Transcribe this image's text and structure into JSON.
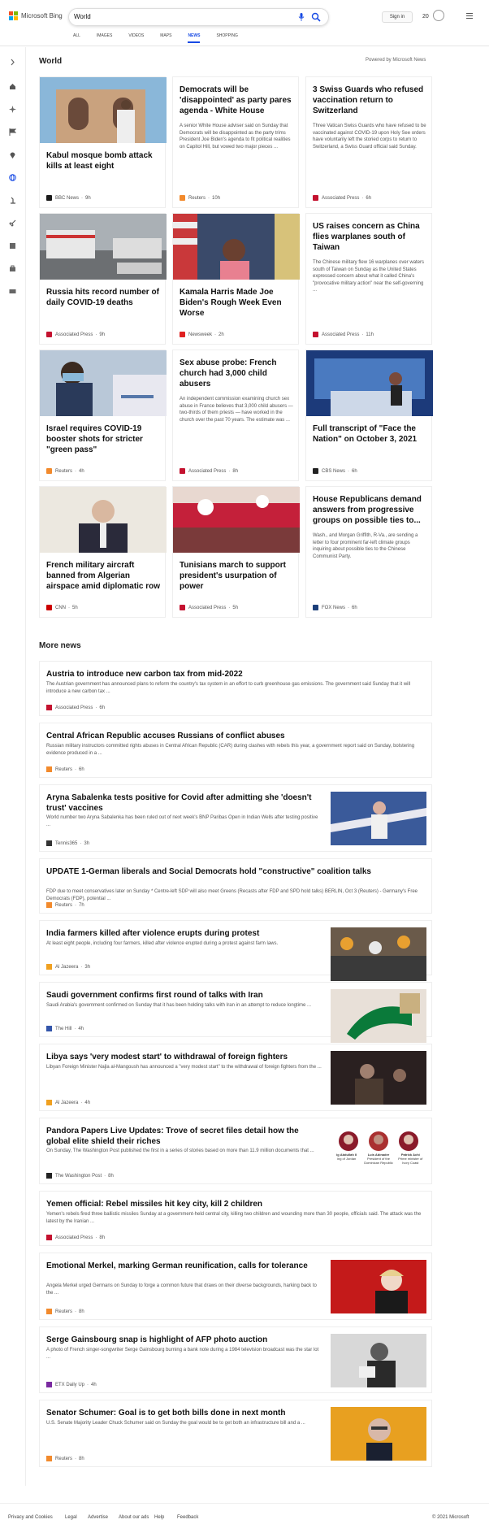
{
  "header": {
    "logo_text": "Microsoft Bing",
    "search_value": "World",
    "sign_in": "Sign in",
    "points": "20",
    "tabs": [
      "ALL",
      "IMAGES",
      "VIDEOS",
      "MAPS",
      "NEWS",
      "SHOPPING"
    ],
    "active_tab": "NEWS"
  },
  "section_title": "World",
  "powered_by": "Powered by Microsoft News",
  "cards": [
    {
      "title": "Kabul mosque bomb attack kills at least eight",
      "desc": "",
      "source": "BBC News",
      "time": "9h",
      "has_image": true,
      "logo_color": "#1a1a1a"
    },
    {
      "title": "Democrats will be 'disappointed' as party pares agenda - White House",
      "desc": "A senior White House adviser said on Sunday that Democrats will be disappointed as the party trims President Joe Biden's agenda to fit political realities on Capitol Hill, but vowed two major pieces ...",
      "source": "Reuters",
      "time": "10h",
      "has_image": false,
      "logo_color": "#f28a2c"
    },
    {
      "title": "3 Swiss Guards who refused vaccination return to Switzerland",
      "desc": "Three Vatican Swiss Guards who have refused to be vaccinated against COVID-19 upon Holy See orders have voluntarily left the storied corps to return to Switzerland, a Swiss Guard official said Sunday.",
      "source": "Associated Press",
      "time": "6h",
      "has_image": false,
      "logo_color": "#c4122f"
    },
    {
      "title": "Russia hits record number of daily COVID-19 deaths",
      "desc": "",
      "source": "Associated Press",
      "time": "9h",
      "has_image": true,
      "logo_color": "#c4122f"
    },
    {
      "title": "Kamala Harris Made Joe Biden's Rough Week Even Worse",
      "desc": "",
      "source": "Newsweek",
      "time": "2h",
      "has_image": true,
      "logo_color": "#e02020"
    },
    {
      "title": "US raises concern as China flies warplanes south of Taiwan",
      "desc": "The Chinese military flew 16 warplanes over waters south of Taiwan on Sunday as the United States expressed concern about what it called China's \"provocative military action\" near the self-governing ...",
      "source": "Associated Press",
      "time": "11h",
      "has_image": false,
      "logo_color": "#c4122f"
    },
    {
      "title": "Israel requires COVID-19 booster shots for stricter \"green pass\"",
      "desc": "",
      "source": "Reuters",
      "time": "4h",
      "has_image": true,
      "logo_color": "#f28a2c"
    },
    {
      "title": "Sex abuse probe: French church had 3,000 child abusers",
      "desc": "An independent commission examining church sex abuse in France believes that 3,000 child abusers — two-thirds of them priests — have worked in the church over the past 70 years. The estimate was ...",
      "source": "Associated Press",
      "time": "8h",
      "has_image": false,
      "logo_color": "#c4122f"
    },
    {
      "title": "Full transcript of \"Face the Nation\" on October 3, 2021",
      "desc": "",
      "source": "CBS News",
      "time": "6h",
      "has_image": true,
      "logo_color": "#222222"
    },
    {
      "title": "French military aircraft banned from Algerian airspace amid diplomatic row",
      "desc": "",
      "source": "CNN",
      "time": "5h",
      "has_image": true,
      "logo_color": "#cc0000"
    },
    {
      "title": "Tunisians march to support president's usurpation of power",
      "desc": "",
      "source": "Associated Press",
      "time": "5h",
      "has_image": true,
      "logo_color": "#c4122f"
    },
    {
      "title": "House Republicans demand answers from progressive groups on possible ties to...",
      "desc": "Wash., and Morgan Griffith, R-Va., are sending a letter to four prominent far-left climate groups inquiring about possible ties to the Chinese Communist Party.",
      "source": "FOX News",
      "time": "6h",
      "has_image": false,
      "logo_color": "#1c3f7a"
    }
  ],
  "more_title": "More news",
  "more_items": [
    {
      "title": "Austria to introduce new carbon tax from mid-2022",
      "desc": "The Austrian government has announced plans to reform the country's tax system in an effort to curb greenhouse gas emissions. The government said Sunday that it will introduce a new carbon tax ...",
      "source": "Associated Press",
      "time": "6h",
      "logo_color": "#c4122f",
      "has_image": false
    },
    {
      "title": "Central African Republic accuses Russians of conflict abuses",
      "desc": "Russian military instructors committed rights abuses in Central African Republic (CAR) during clashes with rebels this year, a government report said on Sunday, bolstering evidence produced in a ...",
      "source": "Reuters",
      "time": "6h",
      "logo_color": "#f28a2c",
      "has_image": false
    },
    {
      "title": "Aryna Sabalenka tests positive for Covid after admitting she 'doesn't trust' vaccines",
      "desc": "World number two Aryna Sabalenka has been ruled out of next week's BNP Paribas Open in Indian Wells after testing positive ...",
      "source": "Tennis365",
      "time": "3h",
      "logo_color": "#333333",
      "has_image": true
    },
    {
      "title": "UPDATE 1-German liberals and Social Democrats hold \"constructive\" coalition talks",
      "desc": "FDP due to meet conservatives later on Sunday * Centre-left SDP will also meet Greens (Recasts after FDP and SPD hold talks) BERLIN, Oct 3 (Reuters) - Germany's Free Democrats (FDP), potential ...",
      "source": "Reuters",
      "time": "7h",
      "logo_color": "#f28a2c",
      "has_image": false
    },
    {
      "title": "India farmers killed after violence erupts during protest",
      "desc": "At least eight people, including four farmers, killed after violence erupted during a protest against farm laws.",
      "source": "Al Jazeera",
      "time": "3h",
      "logo_color": "#f0a020",
      "has_image": true
    },
    {
      "title": "Saudi government confirms first round of talks with Iran",
      "desc": "Saudi Arabia's government confirmed on Sunday that it has been holding talks with Iran in an attempt to reduce longtime ...",
      "source": "The Hill",
      "time": "4h",
      "logo_color": "#3355aa",
      "has_image": true
    },
    {
      "title": "Libya says 'very modest start' to withdrawal of foreign fighters",
      "desc": "Libyan Foreign Minister Najla al-Mangoush has announced a \"very modest start\" to the withdrawal of foreign fighters from the ...",
      "source": "Al Jazeera",
      "time": "4h",
      "logo_color": "#f0a020",
      "has_image": true
    },
    {
      "title": "Pandora Papers Live Updates: Trove of secret files detail how the global elite shield their riches",
      "desc": "On Sunday, The Washington Post published the first in a series of stories based on more than 11.9 million documents that ...",
      "source": "The Washington Post",
      "time": "8h",
      "logo_color": "#222222",
      "has_image": true
    },
    {
      "title": "Yemen official: Rebel missiles hit key city, kill 2 children",
      "desc": "Yemen's rebels fired three ballistic missiles Sunday at a government-held central city, killing two children and wounding more than 30 people, officials said. The attack was the latest by the Iranian ...",
      "source": "Associated Press",
      "time": "8h",
      "logo_color": "#c4122f",
      "has_image": false
    },
    {
      "title": "Emotional Merkel, marking German reunification, calls for tolerance",
      "desc": "Angela Merkel urged Germans on Sunday to forge a common future that draws on their diverse backgrounds, harking back to the ...",
      "source": "Reuters",
      "time": "8h",
      "logo_color": "#f28a2c",
      "has_image": true
    },
    {
      "title": "Serge Gainsbourg snap is highlight of AFP photo auction",
      "desc": "A photo of French singer-songwriter Serge Gainsbourg burning a bank note during a 1984 television broadcast was the star lot ...",
      "source": "ETX Daily Up",
      "time": "4h",
      "logo_color": "#7a2aa0",
      "has_image": true
    },
    {
      "title": "Senator Schumer: Goal is to get both bills done in next month",
      "desc": "U.S. Senate Majority Leader Chuck Schumer said on Sunday the goal would be to get both an infrastructure bill and a ...",
      "source": "Reuters",
      "time": "8h",
      "logo_color": "#f28a2c",
      "has_image": true
    }
  ],
  "pandora_captions": [
    {
      "name": "ig Abdullah II",
      "role": "ing of Jordan"
    },
    {
      "name": "Luis Abinader",
      "role": "President of the Dominican Republic"
    },
    {
      "name": "Patrick Achi",
      "role": "Prime minister of Ivory Coast"
    }
  ],
  "footer": {
    "links": [
      "Privacy and Cookies",
      "Legal",
      "Advertise",
      "About our ads",
      "Help",
      "Feedback"
    ],
    "copyright": "© 2021 Microsoft"
  }
}
